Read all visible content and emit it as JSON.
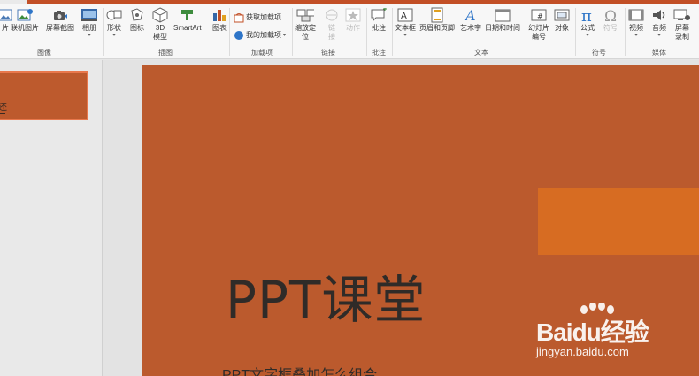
{
  "ribbon": {
    "groups": {
      "images": {
        "label": "图像",
        "buttons": [
          "片",
          "联机图片",
          "屏幕截图",
          "相册"
        ]
      },
      "illustrations": {
        "label": "插图",
        "buttons": [
          "形状",
          "图标",
          "3D 模型",
          "SmartArt",
          "图表"
        ]
      },
      "addins": {
        "label": "加载项",
        "get_addins": "获取加载项",
        "my_addins": "我的加载项"
      },
      "links": {
        "label": "链接",
        "zoom": "缩放定位",
        "link": "链接",
        "action": "动作"
      },
      "comments": {
        "label": "批注",
        "comment": "批注"
      },
      "text": {
        "label": "文本",
        "buttons": [
          "文本框",
          "页眉和页脚",
          "艺术字",
          "日期和时间",
          "幻灯片编号",
          "对象"
        ]
      },
      "symbols": {
        "label": "符号",
        "equation": "公式",
        "symbol": "符号"
      },
      "media": {
        "label": "媒体",
        "video": "视频",
        "audio": "音频",
        "screen_record": "屏幕录制"
      }
    }
  },
  "thumbnail": {
    "text": "还"
  },
  "slide": {
    "title": "PPT课堂",
    "subtitle": "PPT文字框叠加怎么组合"
  },
  "watermark": {
    "brand": "Baidu经验",
    "url": "jingyan.baidu.com"
  },
  "colors": {
    "accent": "#c24f26",
    "slide_bg": "#bb5a2d",
    "slide_rect": "#d76c22"
  }
}
